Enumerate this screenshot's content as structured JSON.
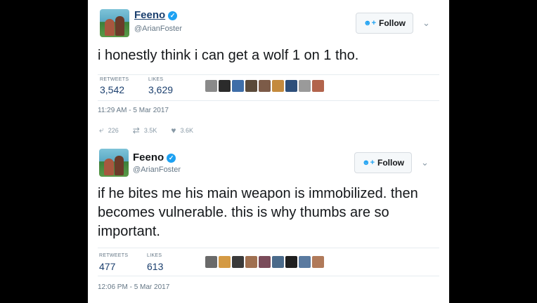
{
  "tweets": [
    {
      "name": "Feeno",
      "handle": "@ArianFoster",
      "follow_label": "Follow",
      "text": "i honestly think i can get a wolf 1 on 1 tho.",
      "retweets_label": "RETWEETS",
      "retweets": "3,542",
      "likes_label": "LIKES",
      "likes": "3,629",
      "timestamp": "11:29 AM - 5 Mar 2017",
      "actions": {
        "reply": "226",
        "retweet": "3.5K",
        "like": "3.6K"
      }
    },
    {
      "name": "Feeno",
      "handle": "@ArianFoster",
      "follow_label": "Follow",
      "text": "if he bites me his main weapon is immobilized. then becomes vulnerable. this is why thumbs are so important.",
      "retweets_label": "RETWEETS",
      "retweets": "477",
      "likes_label": "LIKES",
      "likes": "613",
      "timestamp": "12:06 PM - 5 Mar 2017"
    }
  ],
  "icons": {
    "verified": "verified-badge-icon",
    "follow": "add-user-icon",
    "chevron": "chevron-down-icon",
    "reply": "reply-icon",
    "retweet": "retweet-icon",
    "like": "heart-icon"
  },
  "colors": {
    "brand": "#1da1f2",
    "link": "#1b3f6e",
    "muted": "#657786"
  }
}
